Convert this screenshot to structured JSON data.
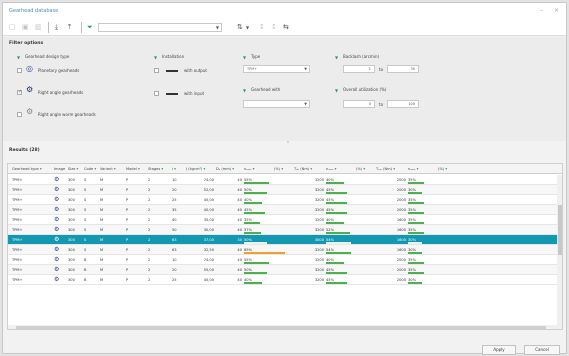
{
  "window": {
    "title": "Gearhead database",
    "minimize": "–",
    "close": "×"
  },
  "toolbar": {
    "dropdown_value": "",
    "colors": {
      "accent": "#4a8ec6",
      "funnel": "#2a9a55"
    }
  },
  "filters": {
    "title": "Filter options",
    "design_type": {
      "label": "Gearhead design type",
      "options": [
        {
          "label": "Planetary gearheads",
          "checked": false
        },
        {
          "label": "Right angle gearheads",
          "checked": true
        },
        {
          "label": "Right angle worm gearheads",
          "checked": false
        }
      ]
    },
    "installation": {
      "label": "Installation",
      "options": [
        {
          "label": "with output",
          "checked": false
        },
        {
          "label": "with input",
          "checked": false
        }
      ]
    },
    "type": {
      "label": "Type",
      "value": "TPM+"
    },
    "gearhead_with": {
      "label": "Gearhead with",
      "value": ""
    },
    "backlash": {
      "label": "Backlash (arcmin)",
      "from": "1",
      "to_label": "to",
      "to": "30"
    },
    "utilization": {
      "label": "Overall utilization (%)",
      "from": "0",
      "to_label": "to",
      "to": "100"
    }
  },
  "results": {
    "title": "Results (28)",
    "columns": [
      "Gearhead type",
      "Image",
      "Size",
      "Code",
      "Variant",
      "Model",
      "Stages",
      "i",
      "J (kgcm²)",
      "Dₐ (mm)",
      "nₘₐₓ",
      "(%)",
      "Tₐₖ (Nm)",
      "nₘₐₓ",
      "(%)",
      "Tₑₘ (Nm)",
      "nₘₐₓ",
      "(%)"
    ],
    "rows": [
      {
        "type": "TPM+",
        "size": "300",
        "code": "S",
        "variant": "M",
        "model": "P",
        "stages": "2",
        "i": "10",
        "j": "74,00",
        "d": "40",
        "p1": "55%",
        "t1": "3200",
        "p2": "40%",
        "t2": "2000",
        "p3": "35%",
        "b1": 0.55,
        "b2": 0.4,
        "b3": 0.35,
        "o1": false
      },
      {
        "type": "TPM+",
        "size": "300",
        "code": "S",
        "variant": "M",
        "model": "P",
        "stages": "2",
        "i": "20",
        "j": "52,00",
        "d": "40",
        "p1": "50%",
        "t1": "3200",
        "p2": "45%",
        "t2": "2000",
        "p3": "30%",
        "b1": 0.5,
        "b2": 0.45,
        "b3": 0.3,
        "o1": false
      },
      {
        "type": "TPM+",
        "size": "300",
        "code": "S",
        "variant": "M",
        "model": "P",
        "stages": "2",
        "i": "25",
        "j": "45,00",
        "d": "40",
        "p1": "40%",
        "t1": "3200",
        "p2": "45%",
        "t2": "2000",
        "p3": "35%",
        "b1": 0.4,
        "b2": 0.45,
        "b3": 0.35,
        "o1": false
      },
      {
        "type": "TPM+",
        "size": "300",
        "code": "S",
        "variant": "M",
        "model": "P",
        "stages": "2",
        "i": "35",
        "j": "40,00",
        "d": "40",
        "p1": "45%",
        "t1": "3200",
        "p2": "45%",
        "t2": "2000",
        "p3": "35%",
        "b1": 0.45,
        "b2": 0.45,
        "b3": 0.35,
        "o1": false
      },
      {
        "type": "TPM+",
        "size": "300",
        "code": "S",
        "variant": "M",
        "model": "P",
        "stages": "2",
        "i": "40",
        "j": "35,00",
        "d": "40",
        "p1": "35%",
        "t1": "3200",
        "p2": "40%",
        "t2": "1600",
        "p3": "35%",
        "b1": 0.35,
        "b2": 0.4,
        "b3": 0.35,
        "o1": false
      },
      {
        "type": "TPM+",
        "size": "300",
        "code": "S",
        "variant": "M",
        "model": "P",
        "stages": "2",
        "i": "50",
        "j": "30,00",
        "d": "40",
        "p1": "37%",
        "t1": "3200",
        "p2": "52%",
        "t2": "1600",
        "p3": "35%",
        "b1": 0.37,
        "b2": 0.52,
        "b3": 0.35,
        "o1": false
      },
      {
        "type": "TPM+",
        "size": "300",
        "code": "S",
        "variant": "M",
        "model": "P",
        "stages": "2",
        "i": "63",
        "j": "37,00",
        "d": "30",
        "p1": "50%",
        "t1": "3000",
        "p2": "54%",
        "t2": "1600",
        "p3": "30%",
        "b1": 0.5,
        "b2": 0.54,
        "b3": 0.3,
        "o1": false,
        "selected": true
      },
      {
        "type": "TPM+",
        "size": "300",
        "code": "S",
        "variant": "M",
        "model": "P",
        "stages": "2",
        "i": "63",
        "j": "32,50",
        "d": "40",
        "p1": "89%",
        "t1": "3200",
        "p2": "54%",
        "t2": "1600",
        "p3": "30%",
        "b1": 0.89,
        "b2": 0.54,
        "b3": 0.3,
        "o1": true
      },
      {
        "type": "TPM+",
        "size": "300",
        "code": "B",
        "variant": "M",
        "model": "P",
        "stages": "2",
        "i": "10",
        "j": "74,00",
        "d": "40",
        "p1": "55%",
        "t1": "3200",
        "p2": "40%",
        "t2": "2000",
        "p3": "35%",
        "b1": 0.55,
        "b2": 0.4,
        "b3": 0.35,
        "o1": false
      },
      {
        "type": "TPM+",
        "size": "300",
        "code": "B",
        "variant": "M",
        "model": "P",
        "stages": "2",
        "i": "20",
        "j": "55,00",
        "d": "40",
        "p1": "50%",
        "t1": "3200",
        "p2": "45%",
        "t2": "2000",
        "p3": "35%",
        "b1": 0.5,
        "b2": 0.45,
        "b3": 0.35,
        "o1": false
      },
      {
        "type": "TPM+",
        "size": "300",
        "code": "B",
        "variant": "M",
        "model": "P",
        "stages": "2",
        "i": "25",
        "j": "45,00",
        "d": "40",
        "p1": "40%",
        "t1": "3200",
        "p2": "45%",
        "t2": "2000",
        "p3": "30%",
        "b1": 0.4,
        "b2": 0.45,
        "b3": 0.3,
        "o1": false
      }
    ]
  },
  "buttons": {
    "apply": "Apply",
    "cancel": "Cancel"
  }
}
